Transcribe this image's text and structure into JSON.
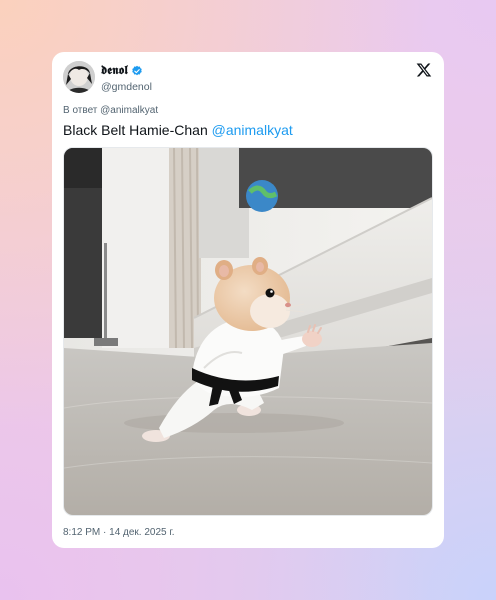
{
  "author": {
    "display_name": "𝖉𝖊𝖓𝖔𝖑",
    "handle": "@gmdenol",
    "verified": true,
    "verified_color": "#1d9bf0"
  },
  "platform_icon": "x-logo-icon",
  "reply": {
    "label": "В ответ @animalkyat"
  },
  "tweet": {
    "text": "Black Belt Hamie-Chan ",
    "mention": "@animalkyat",
    "mention_color": "#1d9bf0"
  },
  "media": {
    "icon": "photo-hamster-karate"
  },
  "timestamp": "8:12 PM · 14 дек. 2025 г."
}
